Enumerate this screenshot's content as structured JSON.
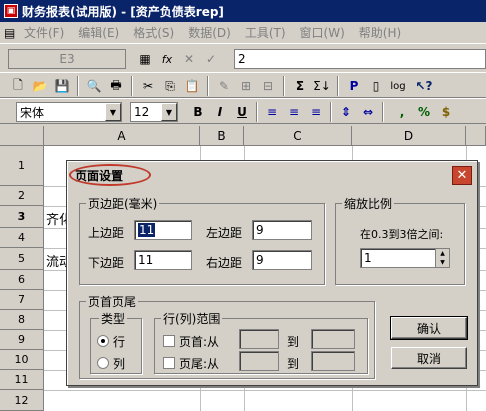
{
  "window": {
    "title": "财务报表(试用版) - [资产负债表rep]"
  },
  "menu": [
    "文件(F)",
    "编辑(E)",
    "格式(S)",
    "数据(D)",
    "工具(T)",
    "窗口(W)",
    "帮助(H)"
  ],
  "formula_bar": {
    "cell_ref": "E3",
    "value": "2",
    "fx_label": "fx"
  },
  "format_bar": {
    "font": "宋体",
    "size": "12",
    "bold": "B",
    "italic": "I",
    "underline": "U",
    "comma": ",",
    "percent": "%",
    "currency": "$"
  },
  "toolbar": {
    "sum": "Σ",
    "p_button": "P",
    "log_button": "log"
  },
  "sheet": {
    "columns": [
      "A",
      "B",
      "C",
      "D"
    ],
    "rows": [
      "1",
      "2",
      "3",
      "4",
      "5",
      "6",
      "7",
      "8",
      "9",
      "10",
      "11",
      "12"
    ],
    "visible_text": {
      "r3": "齐化",
      "r5": "流动"
    }
  },
  "dialog": {
    "title": "页面设置",
    "margins": {
      "legend": "页边距(毫米)",
      "top_label": "上边距",
      "top_value": "11",
      "left_label": "左边距",
      "left_value": "9",
      "bottom_label": "下边距",
      "bottom_value": "11",
      "right_label": "右边距",
      "right_value": "9"
    },
    "scale": {
      "legend": "缩放比例",
      "hint": "在0.3到3倍之间:",
      "value": "1"
    },
    "header_footer": {
      "legend": "页首页尾",
      "type_legend": "类型",
      "type_options": [
        "行",
        "列"
      ],
      "type_selected": "行",
      "range_legend": "行(列)范围",
      "header_label": "页首:从",
      "footer_label": "页尾:从",
      "to_label": "到"
    },
    "buttons": {
      "ok": "确认",
      "cancel": "取消"
    }
  }
}
